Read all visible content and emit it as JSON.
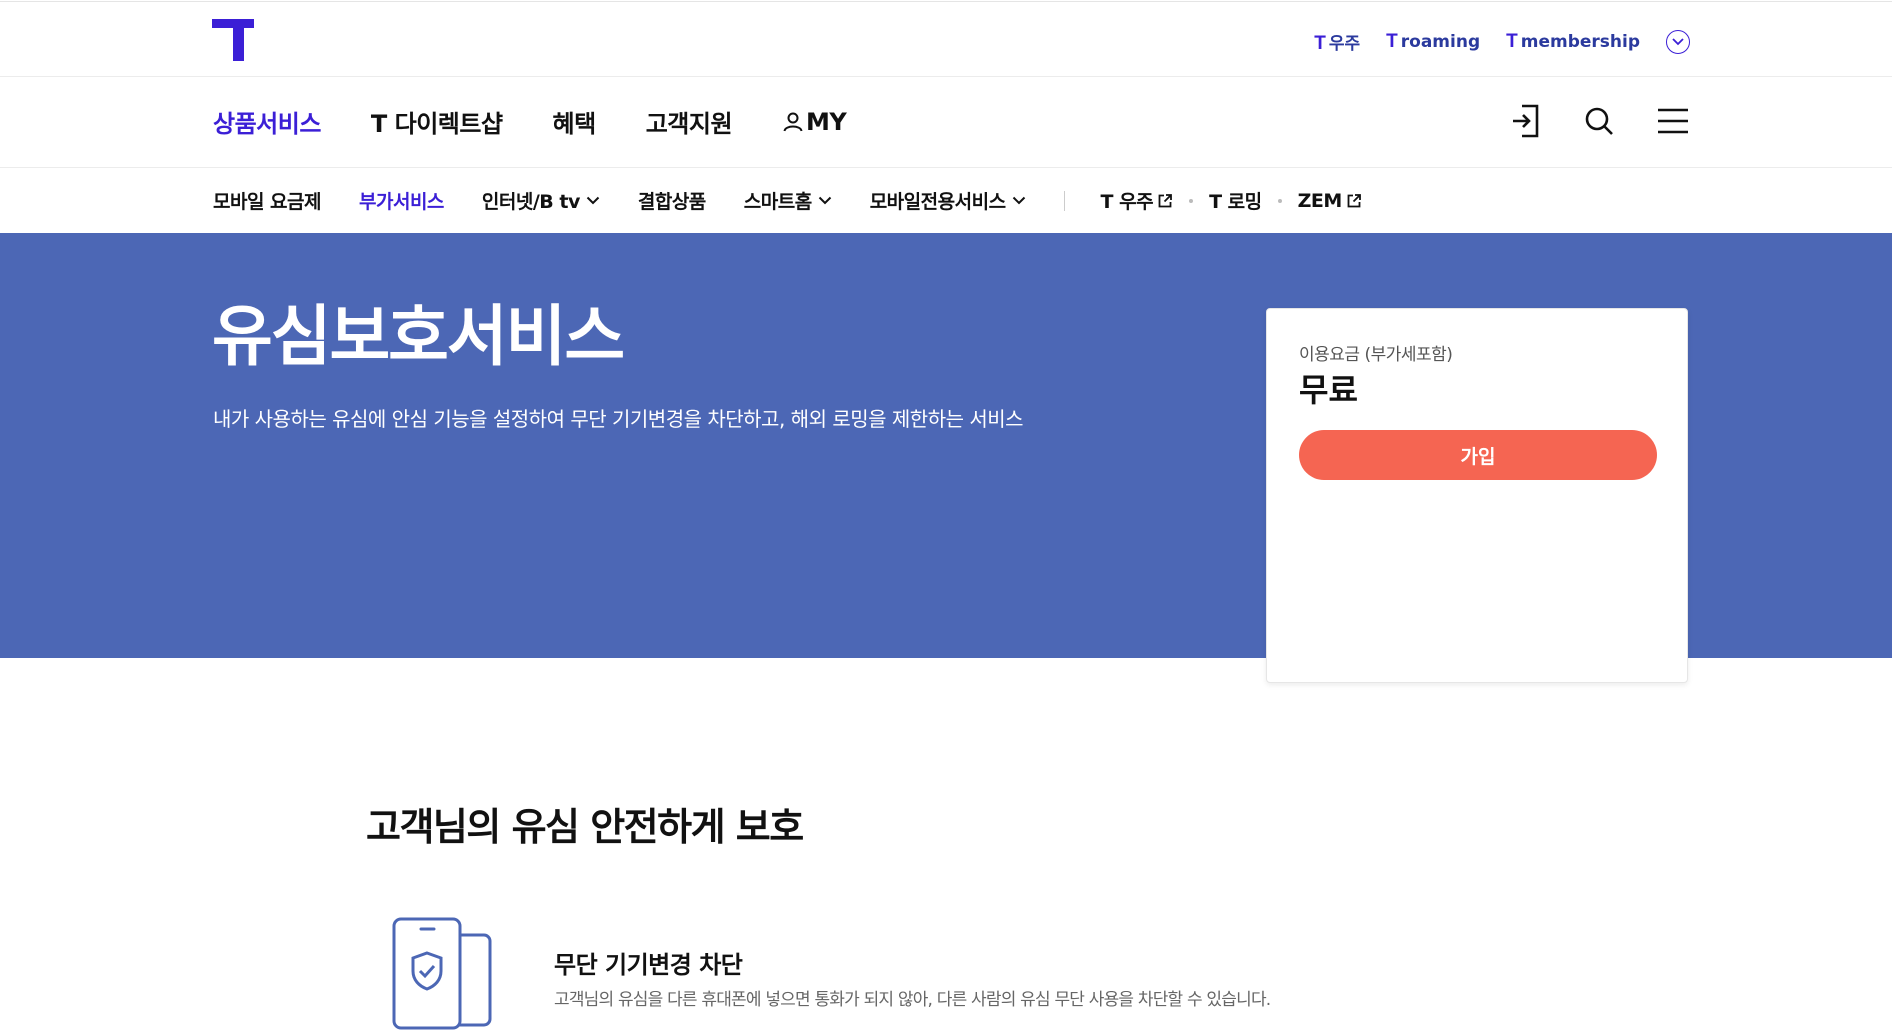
{
  "header": {
    "util_links": [
      {
        "prefix": "T",
        "label": "우주"
      },
      {
        "prefix": "T",
        "label": "roaming"
      },
      {
        "prefix": "T",
        "label": "membership"
      }
    ],
    "util_more_icon": "chevron-circle-down-icon"
  },
  "gnb": {
    "items": [
      {
        "label": "상품서비스",
        "active": true
      },
      {
        "label": "T 다이렉트샵",
        "active": false
      },
      {
        "label": "혜택",
        "active": false
      },
      {
        "label": "고객지원",
        "active": false
      },
      {
        "label": "MY",
        "active": false,
        "icon": "person-icon"
      }
    ],
    "icons": [
      "login-icon",
      "search-icon",
      "menu-icon"
    ]
  },
  "lnb": {
    "items": [
      {
        "label": "모바일 요금제",
        "active": false
      },
      {
        "label": "부가서비스",
        "active": true
      },
      {
        "label": "인터넷/B tv",
        "active": false,
        "dropdown": true
      },
      {
        "label": "결합상품",
        "active": false
      },
      {
        "label": "스마트홈",
        "active": false,
        "dropdown": true
      },
      {
        "label": "모바일전용서비스",
        "active": false,
        "dropdown": true
      }
    ],
    "external": [
      {
        "label": "T 우주",
        "external": true
      },
      {
        "label": "T 로밍",
        "external": false
      },
      {
        "label": "ZEM",
        "external": true
      }
    ]
  },
  "hero": {
    "title": "유심보호서비스",
    "description": "내가 사용하는 유심에 안심 기능을 설정하여 무단 기기변경을 차단하고, 해외 로밍을 제한하는 서비스",
    "background_color": "#4c67b5"
  },
  "price_card": {
    "label": "이용요금 (부가세포함)",
    "value": "무료",
    "join_label": "가입",
    "join_color": "#f56552"
  },
  "section": {
    "title": "고객님의 유심 안전하게 보호",
    "feature": {
      "icon": "phone-shield-icon",
      "title": "무단 기기변경 차단",
      "description": "고객님의 유심을 다른 휴대폰에 넣으면 통화가 되지 않아, 다른 사람의 유심 무단 사용을 차단할 수 있습니다."
    }
  },
  "colors": {
    "brand": "#3b1fd6",
    "hero_bg": "#4c67b5",
    "cta": "#f56552"
  }
}
